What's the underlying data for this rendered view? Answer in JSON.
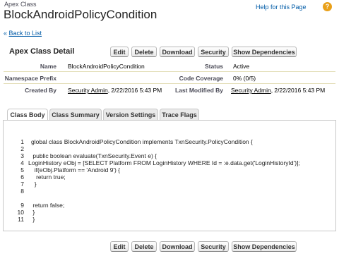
{
  "header": {
    "object_type": "Apex Class",
    "title": "BlockAndroidPolicyCondition",
    "help_label": "Help for this Page",
    "help_icon": "question-icon",
    "back_prefix": "« ",
    "back_label": "Back to List"
  },
  "detail": {
    "section_title": "Apex Class Detail",
    "buttons": [
      "Edit",
      "Delete",
      "Download",
      "Security",
      "Show Dependencies"
    ],
    "fields": {
      "name_label": "Name",
      "name_value": "BlockAndroidPolicyCondition",
      "status_label": "Status",
      "status_value": "Active",
      "namespace_label": "Namespace Prefix",
      "namespace_value": "",
      "coverage_label": "Code Coverage",
      "coverage_value": "0% (0/5)",
      "created_label": "Created By",
      "created_user": "Security Admin",
      "created_date": ", 2/22/2016 5:43 PM",
      "modified_label": "Last Modified By",
      "modified_user": "Security Admin",
      "modified_date": ", 2/22/2016 5:43 PM"
    }
  },
  "tabs": [
    {
      "label": "Class Body",
      "active": true
    },
    {
      "label": "Class Summary",
      "active": false
    },
    {
      "label": "Version Settings",
      "active": false
    },
    {
      "label": "Trace Flags",
      "active": false
    }
  ],
  "code": {
    "line_numbers": [
      "1",
      "2",
      "3",
      "4",
      "5",
      "6",
      "7",
      "8",
      "9",
      "10",
      "11"
    ],
    "lines": [
      "global class BlockAndroidPolicyCondition implements TxnSecurity.PolicyCondition {",
      "",
      " public boolean evaluate(TxnSecurity.Event e) {",
      "LoginHistory eObj = [SELECT Platform FROM LoginHistory WHERE Id = :e.data.get('LoginHistoryId')];",
      "  if(eObj.Platform == 'Android 9') {",
      "   return true;",
      "  }",
      "",
      " return false;",
      " }",
      " }"
    ]
  },
  "bottom_buttons": [
    "Edit",
    "Delete",
    "Download",
    "Security",
    "Show Dependencies"
  ],
  "colors": {
    "link": "#015ba7",
    "help_icon": "#e9a019",
    "separator": "#e3deb8"
  }
}
